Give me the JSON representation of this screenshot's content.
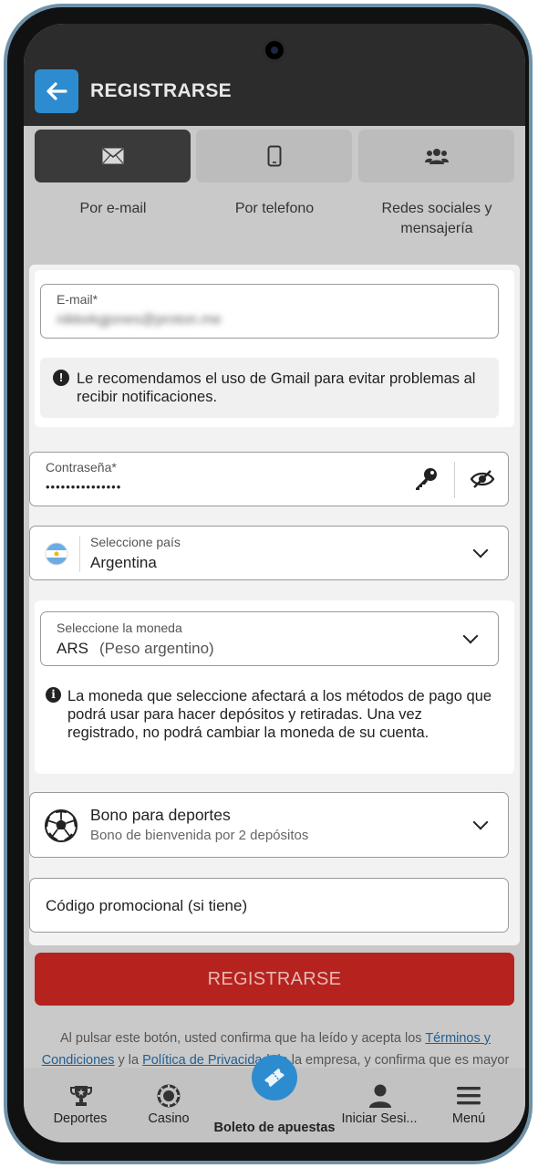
{
  "header": {
    "title": "REGISTRARSE"
  },
  "tabs": [
    {
      "label": "Por e-mail",
      "icon": "envelope-icon",
      "active": true
    },
    {
      "label": "Por telefono",
      "icon": "phone-icon",
      "active": false
    },
    {
      "label": "Redes sociales y mensajería",
      "icon": "users-icon",
      "active": false
    }
  ],
  "email": {
    "label": "E-mail*",
    "value": "nikkekgjones@proton.me",
    "notice": "Le recomendamos el uso de Gmail para evitar problemas al recibir notificaciones."
  },
  "password": {
    "label": "Contraseña*",
    "value": "•••••••••••••••"
  },
  "country": {
    "label": "Seleccione país",
    "value": "Argentina"
  },
  "currency": {
    "label": "Seleccione la moneda",
    "code": "ARS",
    "name": "(Peso argentino)",
    "notice": "La moneda que seleccione afectará a los métodos de pago que podrá usar para hacer depósitos y retiradas. Una vez registrado, no podrá cambiar la moneda de su cuenta."
  },
  "bonus": {
    "title": "Bono para deportes",
    "subtitle": "Bono de bienvenida por 2 depósitos"
  },
  "promo": {
    "placeholder": "Código promocional (si tiene)"
  },
  "register_button": "REGISTRARSE",
  "legal": {
    "part1": "Al pulsar este botón, usted confirma que ha leído y acepta los ",
    "link1": "Términos y Condiciones",
    "part2": " y la ",
    "link2": "Política de Privacidad",
    "part3": " de la empresa, y confirma que es mayor de edad"
  },
  "bottom_nav": [
    {
      "label": "Deportes",
      "icon": "trophy-icon"
    },
    {
      "label": "Casino",
      "icon": "casino-chip-icon"
    },
    {
      "label": "Boleto de apuestas",
      "icon": "ticket-icon"
    },
    {
      "label": "Iniciar Sesi...",
      "icon": "user-icon"
    },
    {
      "label": "Menú",
      "icon": "menu-icon"
    }
  ],
  "colors": {
    "accent_blue": "#2d8ccf",
    "register_red": "#b6231e",
    "header_dark": "#2c2c2c"
  }
}
